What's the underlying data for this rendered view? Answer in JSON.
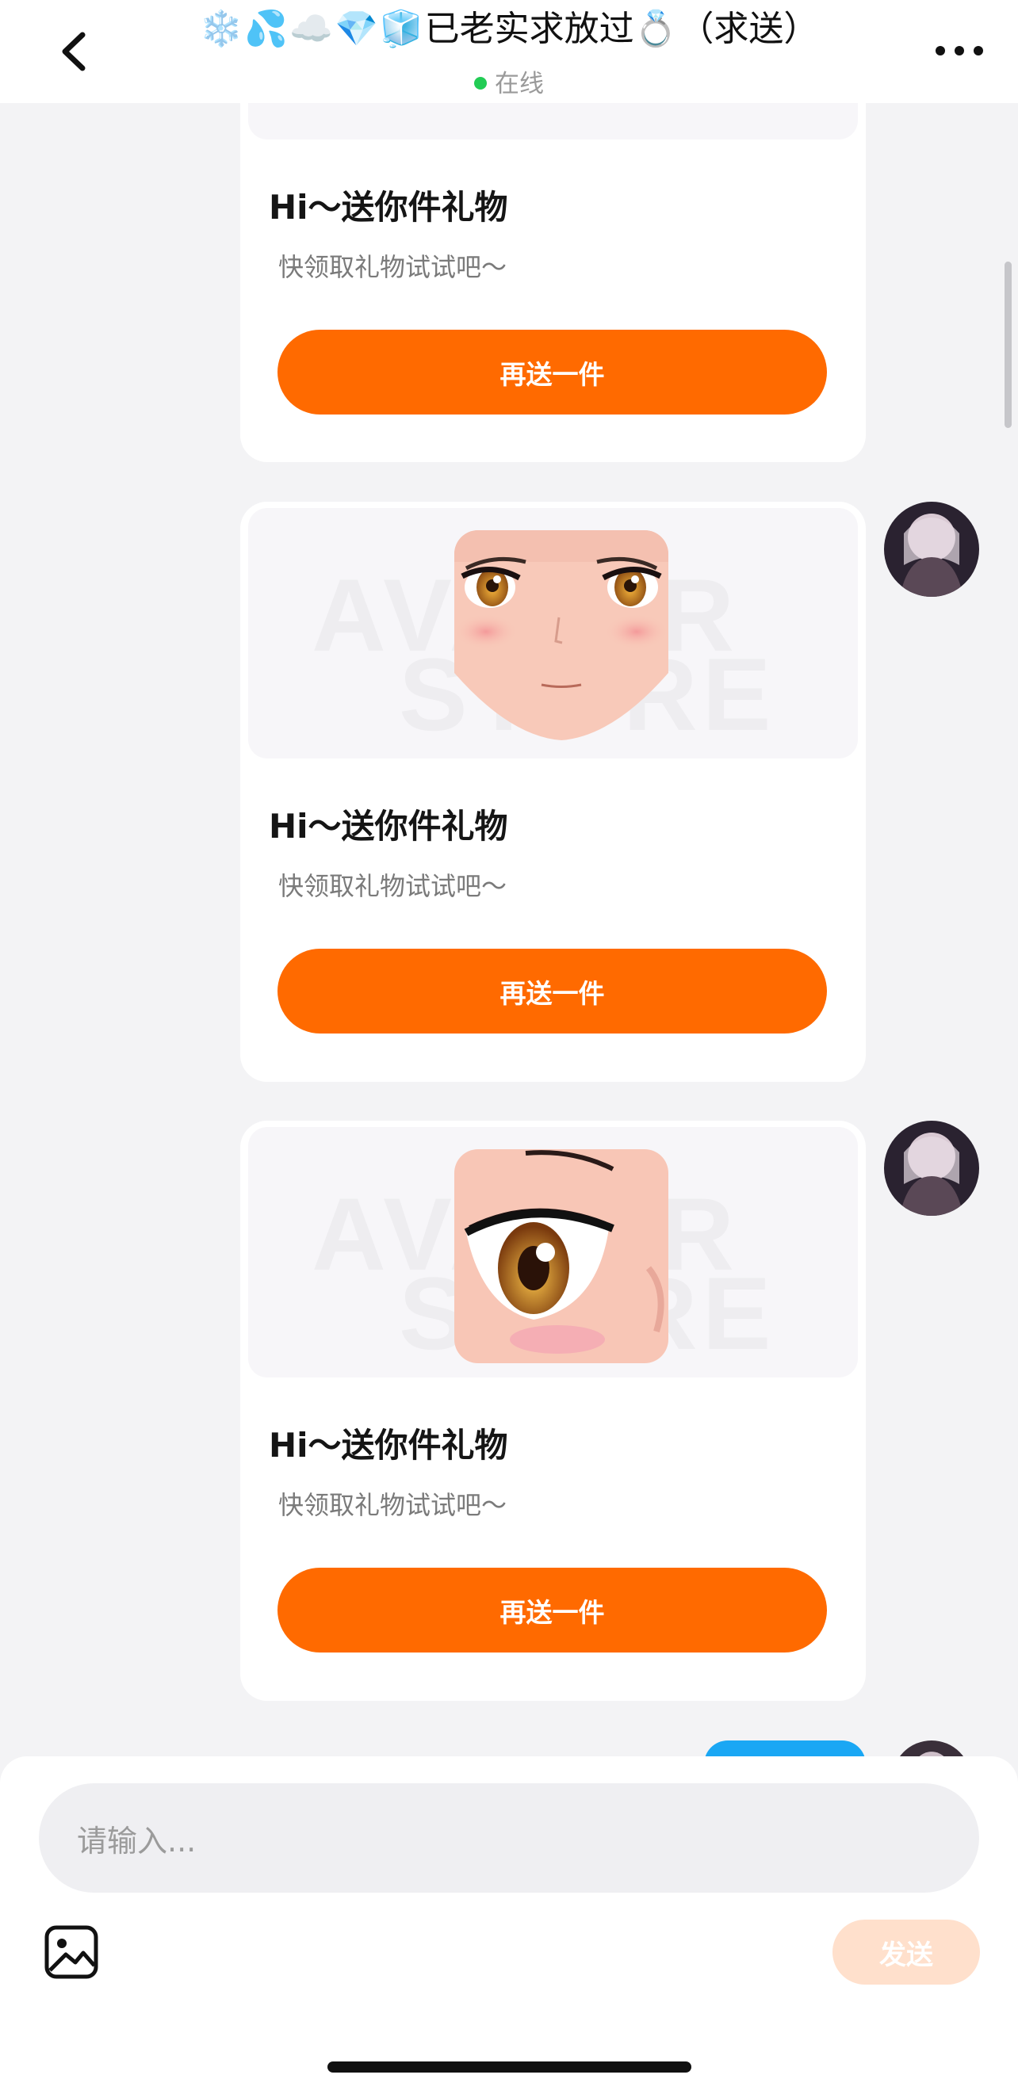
{
  "header": {
    "title_emojis": [
      "❄️",
      "💦",
      "☁️",
      "💎",
      "🧊"
    ],
    "title_text": "已老实求放过",
    "title_ring": "💍",
    "title_suffix": "（求送）",
    "status": "在线",
    "status_color": "#22cc55"
  },
  "messages": [
    {
      "title": "Hi～送你件礼物",
      "subtitle": "快领取礼物试试吧～",
      "button": "再送一件",
      "image": "face-preview"
    },
    {
      "title": "Hi～送你件礼物",
      "subtitle": "快领取礼物试试吧～",
      "button": "再送一件",
      "image": "face-preview",
      "watermark_top": "AVATAR",
      "watermark_bottom": "STORE"
    },
    {
      "title": "Hi～送你件礼物",
      "subtitle": "快领取礼物试试吧～",
      "button": "再送一件",
      "image": "eye-closeup",
      "watermark_top": "AVATAR",
      "watermark_bottom": "STORE"
    }
  ],
  "composer": {
    "placeholder": "请输入...",
    "image_icon": "image-icon",
    "send_label": "发送"
  },
  "colors": {
    "accent": "#ff6a00",
    "send_disabled": "#ffe0cc",
    "own_bubble": "#1aa7f4"
  }
}
